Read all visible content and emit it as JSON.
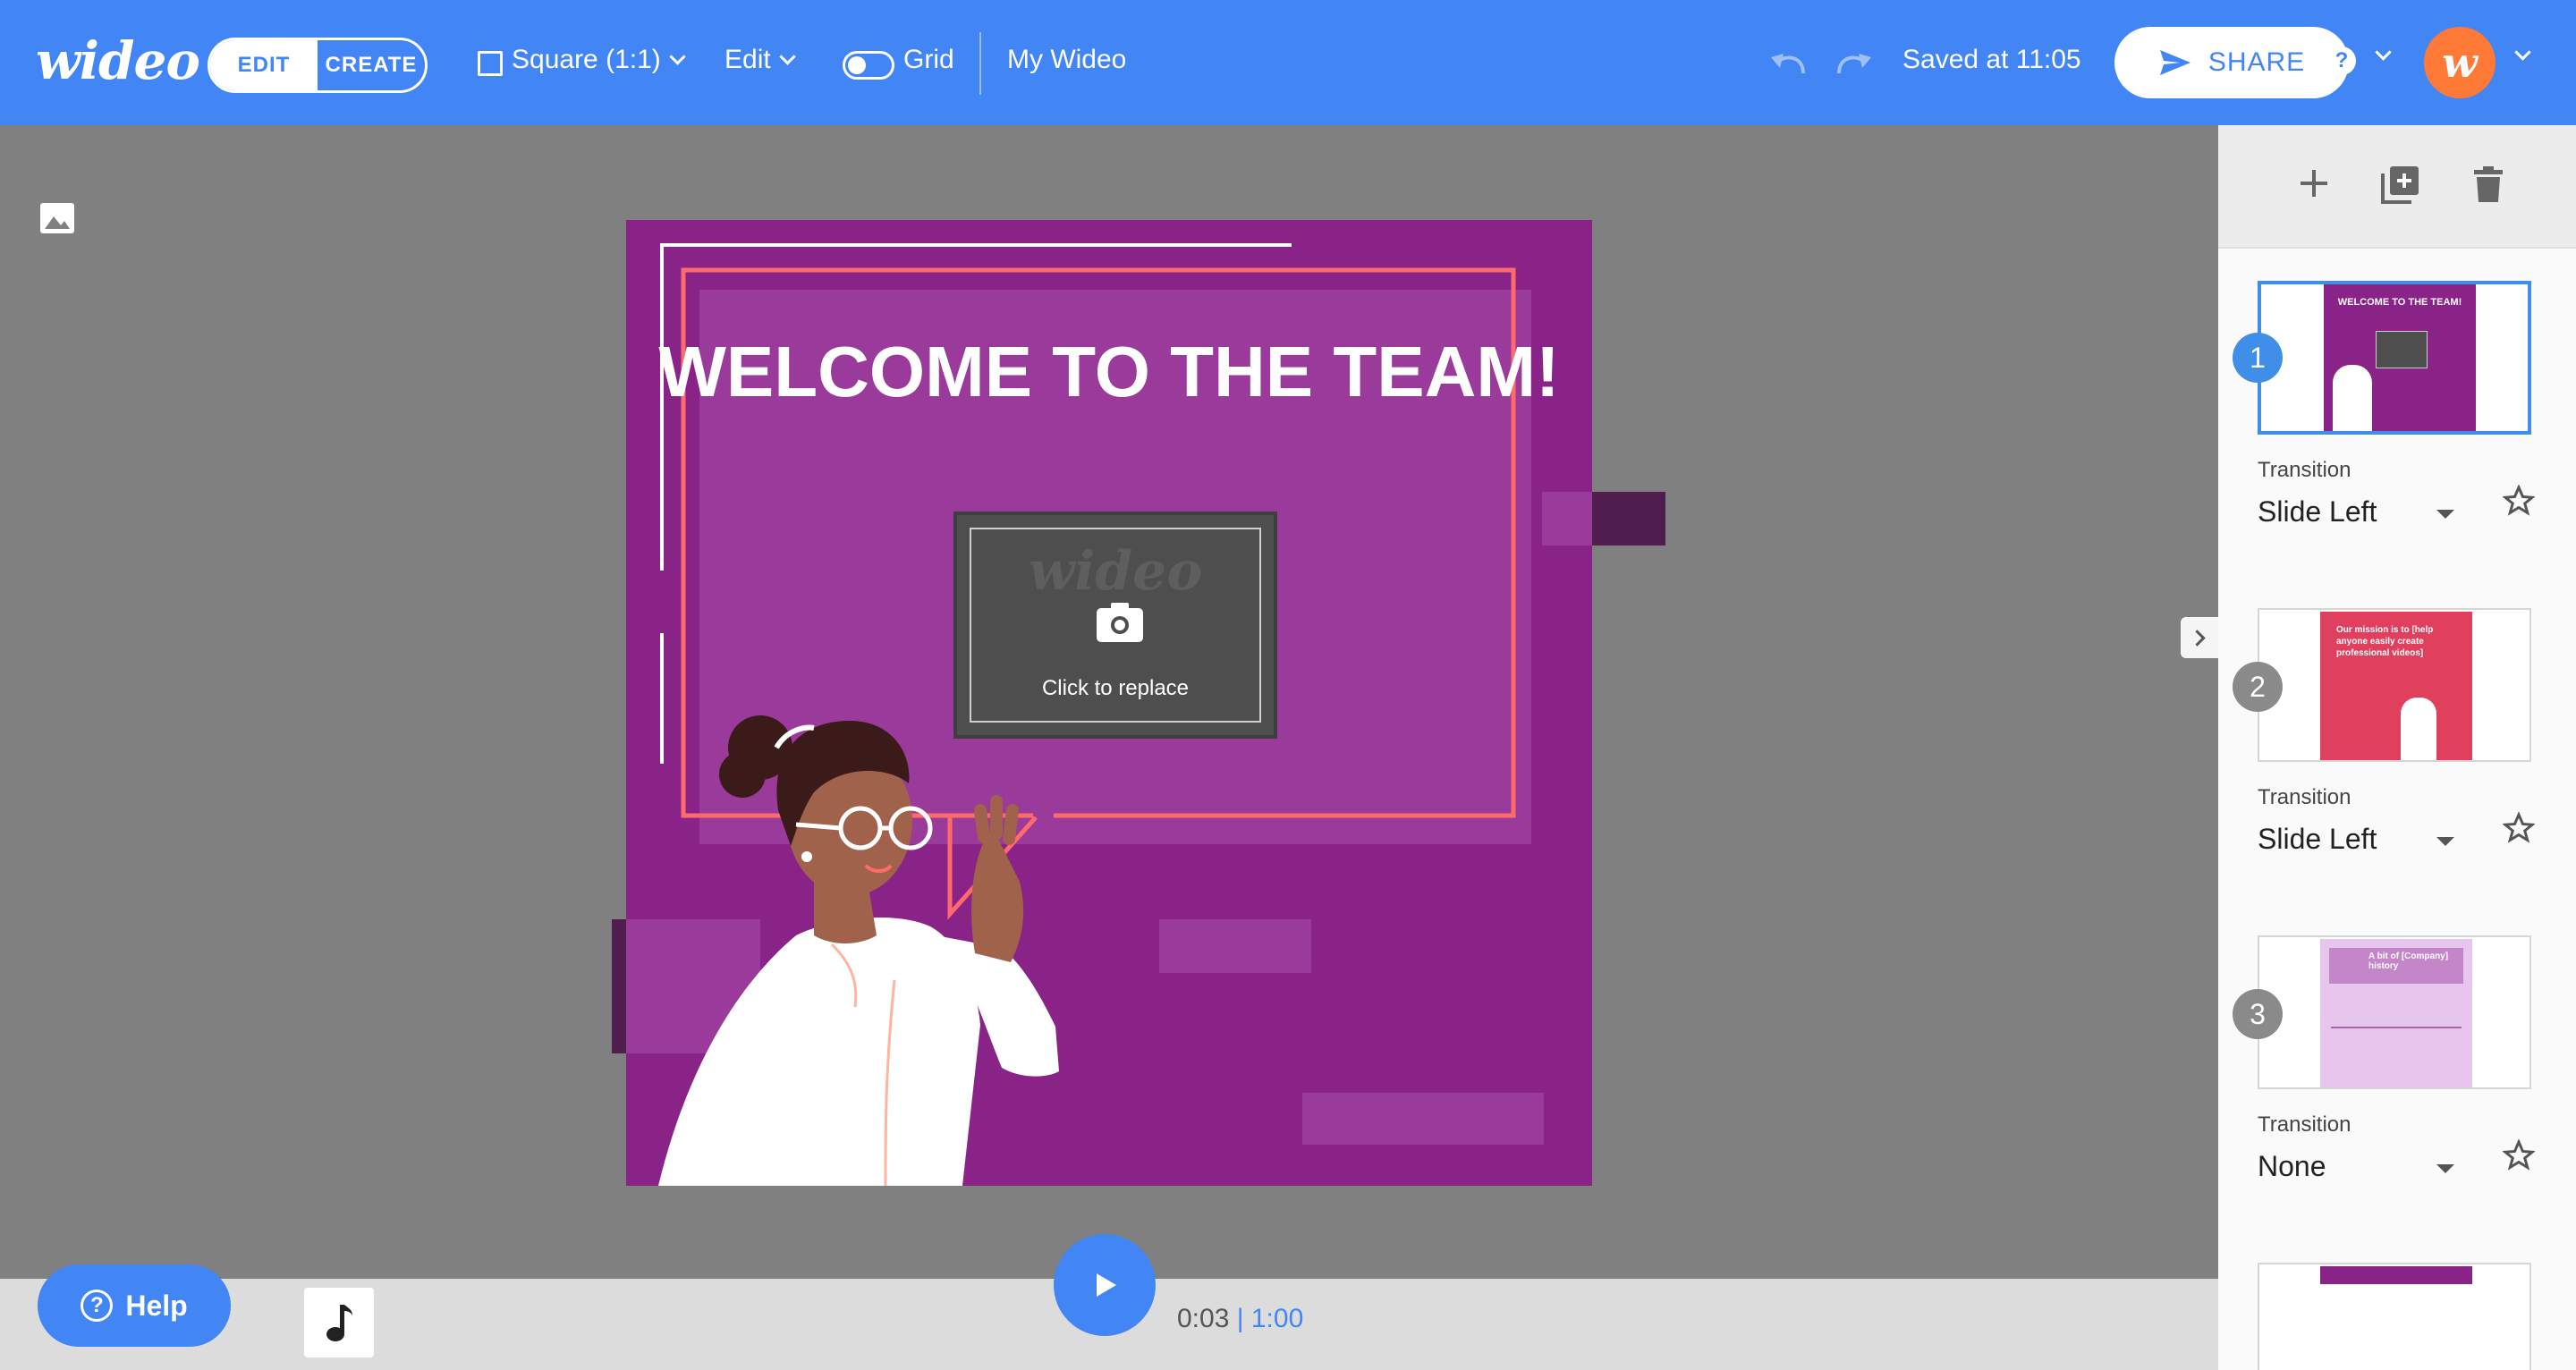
{
  "app": {
    "logo": "wideo"
  },
  "toolbar": {
    "mode_edit": "EDIT",
    "mode_create": "CREATE",
    "format": "Square (1:1)",
    "edit_menu": "Edit",
    "grid_label": "Grid",
    "project_name": "My Wideo",
    "saved_status": "Saved at 11:05",
    "share_label": "SHARE",
    "avatar_letter": "w"
  },
  "canvas": {
    "headline": "WELCOME TO THE TEAM!",
    "placeholder_watermark": "wideo",
    "placeholder_label": "Click to replace"
  },
  "sidebar": {
    "slides": [
      {
        "number": "1",
        "transition_label": "Transition",
        "transition": "Slide Left",
        "preview_text": "WELCOME TO THE TEAM!"
      },
      {
        "number": "2",
        "transition_label": "Transition",
        "transition": "Slide Left",
        "preview_text": "Our mission is to [help anyone easily create professional videos]"
      },
      {
        "number": "3",
        "transition_label": "Transition",
        "transition": "None",
        "preview_text": "A bit of [Company] history"
      }
    ]
  },
  "player": {
    "current_time": "0:03",
    "separator": "|",
    "total_time": "1:00"
  },
  "help": {
    "label": "Help"
  },
  "colors": {
    "topbar": "#4285f4",
    "canvas_bg": "#8a2388",
    "accent_orange": "#ff7a36",
    "frame_coral": "#ff6b6b",
    "selected_thumb": "#3f8fe8"
  }
}
